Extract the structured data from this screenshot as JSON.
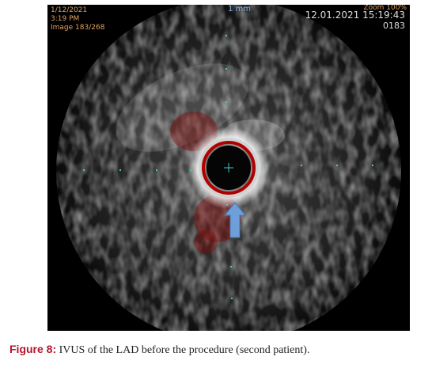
{
  "image": {
    "overlay": {
      "date": "1/12/2021",
      "time": "3:19 PM",
      "image_index": "Image 183/268",
      "scale": "1 mm",
      "zoom": "Zoom 100%",
      "timestamp": "12.01.2021 15:19:43",
      "frame": "0183"
    },
    "arrow_color": "#6f9fd8",
    "marker_color": "#48c8c8",
    "flow_color": "#8b0000"
  },
  "caption": {
    "label": "Figure 8:",
    "text": "IVUS of the LAD before the procedure (second patient)."
  }
}
